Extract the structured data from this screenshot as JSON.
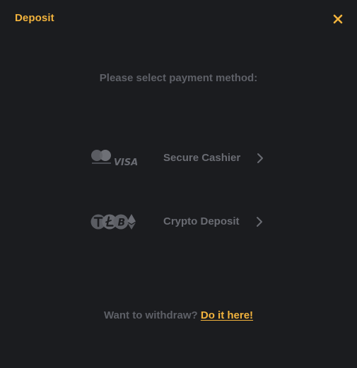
{
  "modal": {
    "title": "Deposit",
    "close_icon": "close-icon",
    "accent_color": "#f2b33d"
  },
  "prompt": "Please select payment method:",
  "methods": [
    {
      "label": "Secure Cashier",
      "icons": [
        "mastercard-icon",
        "visa-icon"
      ],
      "chevron": "chevron-right-icon"
    },
    {
      "label": "Crypto Deposit",
      "icons": [
        "tether-icon",
        "litecoin-icon",
        "bitcoin-icon",
        "ethereum-icon"
      ],
      "chevron": "chevron-right-icon"
    }
  ],
  "withdraw": {
    "text": "Want to withdraw?",
    "link_label": "Do it here!"
  }
}
